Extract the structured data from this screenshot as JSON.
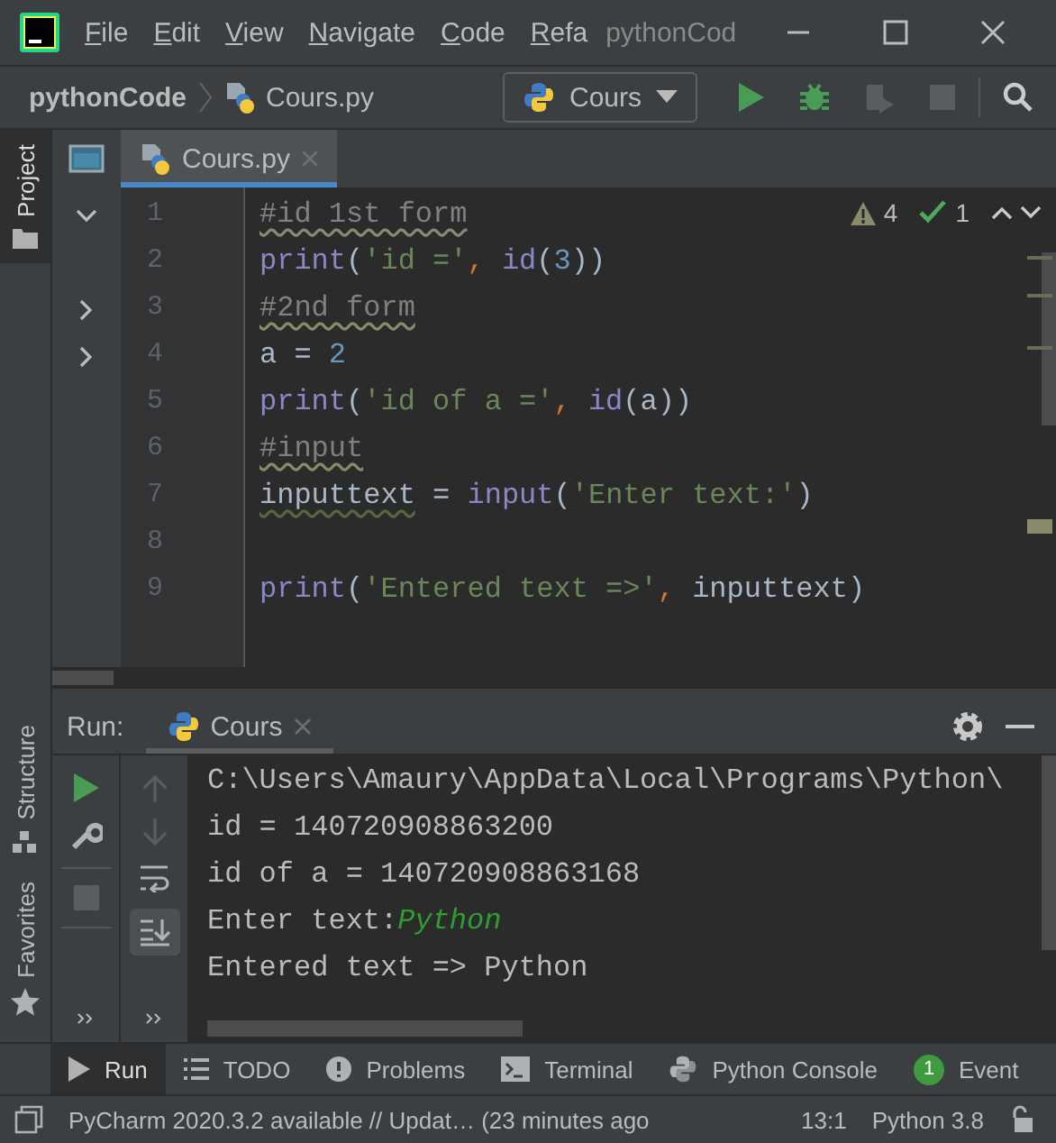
{
  "title_bar": {
    "menu": [
      "File",
      "Edit",
      "View",
      "Navigate",
      "Code",
      "Refa"
    ],
    "title": "pythonCod"
  },
  "nav_bar": {
    "breadcrumbs": [
      "pythonCode",
      "Cours.py"
    ],
    "run_config": "Cours"
  },
  "side_tabs": {
    "top": [
      {
        "label": "Project",
        "selected": true
      }
    ],
    "bottom": [
      {
        "label": "Structure",
        "selected": false
      },
      {
        "label": "Favorites",
        "selected": false
      }
    ]
  },
  "editor": {
    "tabs": [
      {
        "label": "Cours.py",
        "selected": true
      }
    ],
    "inspections": {
      "warnings": "4",
      "weak_warnings": "1"
    },
    "lines": [
      {
        "number": "1",
        "tokens": [
          {
            "kind": "comment",
            "text": "#id 1st form"
          }
        ]
      },
      {
        "number": "2",
        "tokens": [
          {
            "kind": "builtin",
            "text": "print"
          },
          {
            "kind": "text",
            "text": "("
          },
          {
            "kind": "string",
            "text": "'id ='"
          },
          {
            "kind": "comma",
            "text": ", "
          },
          {
            "kind": "builtin",
            "text": "id"
          },
          {
            "kind": "text",
            "text": "("
          },
          {
            "kind": "number",
            "text": "3"
          },
          {
            "kind": "text",
            "text": "))"
          }
        ]
      },
      {
        "number": "3",
        "tokens": [
          {
            "kind": "comment",
            "text": "#2nd form"
          }
        ]
      },
      {
        "number": "4",
        "tokens": [
          {
            "kind": "text",
            "text": "a = "
          },
          {
            "kind": "number",
            "text": "2"
          }
        ]
      },
      {
        "number": "5",
        "tokens": [
          {
            "kind": "builtin",
            "text": "print"
          },
          {
            "kind": "text",
            "text": "("
          },
          {
            "kind": "string",
            "text": "'id of a ='"
          },
          {
            "kind": "comma",
            "text": ", "
          },
          {
            "kind": "builtin",
            "text": "id"
          },
          {
            "kind": "text",
            "text": "(a))"
          }
        ]
      },
      {
        "number": "6",
        "tokens": [
          {
            "kind": "comment",
            "text": "#input"
          }
        ]
      },
      {
        "number": "7",
        "tokens": [
          {
            "kind": "warned",
            "text": "inputtext"
          },
          {
            "kind": "text",
            "text": " = "
          },
          {
            "kind": "builtin",
            "text": "input"
          },
          {
            "kind": "text",
            "text": "("
          },
          {
            "kind": "string",
            "text": "'Enter text:'"
          },
          {
            "kind": "text",
            "text": ")"
          }
        ]
      },
      {
        "number": "8"
      },
      {
        "number": "9",
        "tokens": [
          {
            "kind": "builtin",
            "text": "print"
          },
          {
            "kind": "text",
            "text": "("
          },
          {
            "kind": "string",
            "text": "'Entered text =>'"
          },
          {
            "kind": "comma",
            "text": ", "
          },
          {
            "kind": "text",
            "text": "inputtext)"
          }
        ]
      }
    ]
  },
  "run_panel": {
    "label": "Run:",
    "tabs": [
      {
        "label": "Cours",
        "selected": true
      }
    ],
    "console": [
      [
        {
          "kind": "output",
          "text": "C:\\Users\\Amaury\\AppData\\Local\\Programs\\Python\\"
        }
      ],
      [
        {
          "kind": "output",
          "text": "id = 140720908863200"
        }
      ],
      [
        {
          "kind": "output",
          "text": "id of a = 140720908863168"
        }
      ],
      [
        {
          "kind": "output",
          "text": "Enter text:"
        },
        {
          "kind": "input",
          "text": "Python"
        }
      ],
      [
        {
          "kind": "output",
          "text": "Entered text => Python"
        }
      ]
    ]
  },
  "tool_tabs": [
    {
      "kind": "run",
      "label": "Run",
      "selected": true
    },
    {
      "kind": "todo",
      "label": "TODO",
      "selected": false
    },
    {
      "kind": "problems",
      "label": "Problems",
      "selected": false
    },
    {
      "kind": "terminal",
      "label": "Terminal",
      "selected": false
    },
    {
      "kind": "console",
      "label": "Python Console",
      "selected": false
    },
    {
      "kind": "event",
      "label": "Event",
      "badge": "1",
      "selected": false
    }
  ],
  "status_bar": {
    "message": "PyCharm 2020.3.2 available // Updat… (23 minutes ago",
    "position": "13:1",
    "interpreter": "Python 3.8"
  }
}
